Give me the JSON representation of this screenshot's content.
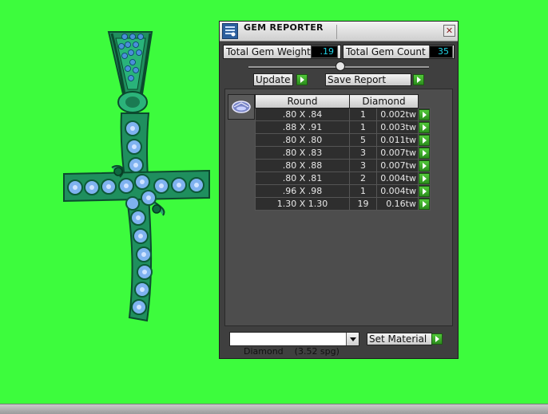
{
  "window": {
    "title": "GEM REPORTER",
    "close_glyph": "✕"
  },
  "summary": {
    "total_weight_label": "Total Gem Weight",
    "total_weight_value": ".19",
    "total_count_label": "Total Gem Count",
    "total_count_value": "35",
    "value_color": "#21d3e6"
  },
  "actions": {
    "update_label": "Update",
    "save_report_label": "Save Report",
    "set_material_label": "Set Material"
  },
  "table": {
    "headers": [
      "Round",
      "Diamond"
    ],
    "rows": [
      {
        "size": ".80 X .84",
        "count": "1",
        "weight": "0.002tw"
      },
      {
        "size": ".88 X .91",
        "count": "1",
        "weight": "0.003tw"
      },
      {
        "size": ".80 X .80",
        "count": "5",
        "weight": "0.011tw"
      },
      {
        "size": ".80 X .83",
        "count": "3",
        "weight": "0.007tw"
      },
      {
        "size": ".80 X .88",
        "count": "3",
        "weight": "0.007tw"
      },
      {
        "size": ".80 X .81",
        "count": "2",
        "weight": "0.004tw"
      },
      {
        "size": ".96 X .98",
        "count": "1",
        "weight": "0.004tw"
      },
      {
        "size": "1.30 X 1.30",
        "count": "19",
        "weight": "0.16tw"
      }
    ]
  },
  "material": {
    "selected": "Diamond    (3.52 spg)"
  },
  "colors": {
    "background": "#3dfc3d",
    "panel": "#3f3f3f",
    "accent_green": "#2b8d1c",
    "gem_blue": "#7fb2f0",
    "metal_teal": "#1e9a6a"
  },
  "icons": [
    "gem-reporter-app-icon",
    "close-icon",
    "go-arrow-icon",
    "gem-shape-icon",
    "chevron-down-icon"
  ]
}
